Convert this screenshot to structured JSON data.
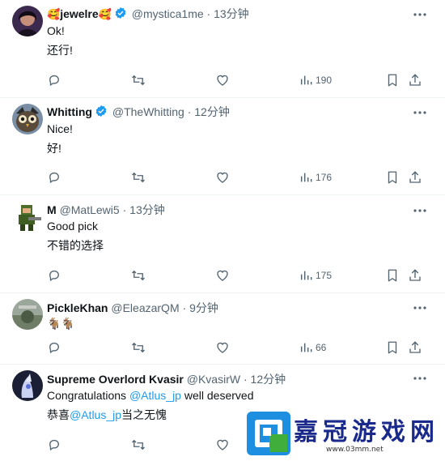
{
  "tweets": [
    {
      "name": "jewelre",
      "name_prefix_emoji": "🥰",
      "name_suffix_emoji": "🥰",
      "verified": true,
      "handle": "@mystica1me",
      "time": "13分钟",
      "lines": [
        "Ok!",
        "还行!"
      ],
      "views": "190"
    },
    {
      "name": "Whitting",
      "verified": true,
      "handle": "@TheWhitting",
      "time": "12分钟",
      "lines": [
        "Nice!",
        "好!"
      ],
      "views": "176"
    },
    {
      "name": "M",
      "verified": false,
      "handle": "@MatLewi5",
      "time": "13分钟",
      "lines": [
        "Good pick",
        "不错的选择"
      ],
      "views": "175"
    },
    {
      "name": "PickleKhan",
      "verified": false,
      "handle": "@EleazarQM",
      "time": "9分钟",
      "lines": [
        "🐐🐐"
      ],
      "views": "66"
    },
    {
      "name": "Supreme Overlord Kvasir",
      "verified": false,
      "handle": "@KvasirW",
      "time": "12分钟",
      "line1_pre": "Congratulations ",
      "line1_mention": "@Atlus_jp",
      "line1_post": " well deserved",
      "line2_pre": "恭喜",
      "line2_mention": "@Atlus_jp",
      "line2_post": "当之无愧"
    }
  ],
  "dot": "·",
  "icons": {
    "reply": "reply-icon",
    "retweet": "retweet-icon",
    "like": "heart-icon",
    "views": "views-chart-icon",
    "bookmark": "bookmark-icon",
    "share": "share-icon",
    "more": "more-dots-icon",
    "verified": "verified-badge-icon"
  },
  "watermark": {
    "chars": [
      "嘉",
      "冠",
      "游",
      "戏",
      "网"
    ],
    "url": "www.03mm.net"
  },
  "colors": {
    "text": "#0f1419",
    "muted": "#536471",
    "accent": "#1d9bf0",
    "separator": "#eff3f4",
    "watermark": "#1a2a8c"
  }
}
